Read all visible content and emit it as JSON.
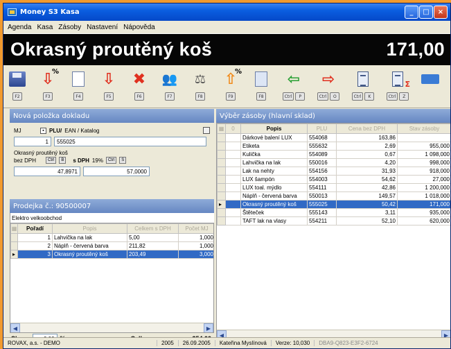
{
  "window": {
    "title": "Money S3 Kasa",
    "controls": {
      "minimize": "_",
      "maximize": "□",
      "close": "×"
    }
  },
  "menu": [
    "Agenda",
    "Kasa",
    "Zásoby",
    "Nastavení",
    "Nápověda"
  ],
  "banner": {
    "item": "Okrasný proutěný koš",
    "price": "171,00"
  },
  "toolbar": [
    {
      "icon": "save-disk-icon",
      "key": "F2"
    },
    {
      "icon": "discount-down-icon",
      "key": "F3"
    },
    {
      "icon": "edit-item-icon",
      "key": "F4"
    },
    {
      "icon": "arrow-down-icon",
      "key": "F5"
    },
    {
      "icon": "delete-x-icon",
      "key": "F6"
    },
    {
      "icon": "customers-icon",
      "key": "F7"
    },
    {
      "icon": "scale-icon",
      "key": "F8"
    },
    {
      "icon": "discount-up-icon",
      "key": "F9"
    },
    {
      "icon": "register-icon",
      "key": "F8"
    },
    {
      "icon": "arrow-left-icon",
      "keys": [
        "Ctrl",
        "P"
      ]
    },
    {
      "icon": "arrow-right-icon",
      "keys": [
        "Ctrl",
        "O"
      ]
    },
    {
      "icon": "document-icon",
      "keys": [
        "Ctrl",
        "K"
      ]
    },
    {
      "icon": "document-sum-icon",
      "keys": [
        "Ctrl",
        "Z"
      ]
    },
    {
      "icon": "keyboard-icon"
    }
  ],
  "new_item": {
    "header": "Nová položka dokladu",
    "mj_label": "MJ",
    "plu_label": "PLU/",
    "ean_label": "EAN / Katalog",
    "quantity": "1",
    "plu": "555025",
    "name": "Okrasný proutěný koš",
    "bez_dph_label": "bez DPH",
    "ctrl": "Ctrl",
    "b_key": "B",
    "s_dph_label": "s DPH",
    "vat": "19%",
    "s_key": "S",
    "price_net": "47,8971",
    "price_gross": "57,0000"
  },
  "receipt": {
    "header": "Prodejka č.: 90500007",
    "customer": "Elektro velkoobchod",
    "columns": [
      "Pořadí",
      "Popis",
      "Celkem s DPH",
      "Počet MJ"
    ],
    "rows": [
      [
        "1",
        "Lahvička na lak",
        "5,00",
        "1,000"
      ],
      [
        "2",
        "Náplň - červená barva",
        "211,82",
        "1,000"
      ],
      [
        "3",
        "Okrasný proutěný koš",
        "203,49",
        "3,000"
      ]
    ],
    "selected_row": 2,
    "discount_label": "Sleva:",
    "discount_value": "0,00",
    "discount_unit": "%",
    "total_label": "Celkem:",
    "total_value": "354,00"
  },
  "stock": {
    "header": "Výběr zásoby (hlavní sklad)",
    "columns": [
      "Popis",
      "PLU",
      "Cena bez DPH",
      "Stav zásoby"
    ],
    "rows": [
      [
        "Dárkové balení LUX",
        "554068",
        "163,86",
        ""
      ],
      [
        "Etiketa",
        "555632",
        "2,69",
        "955,000"
      ],
      [
        "Kulička",
        "554089",
        "0,67",
        "1 098,000"
      ],
      [
        "Lahvička na lak",
        "550016",
        "4,20",
        "998,000"
      ],
      [
        "Lak na nehty",
        "554156",
        "31,93",
        "918,000"
      ],
      [
        "LUX šampón",
        "554003",
        "54,62",
        "27,000"
      ],
      [
        "LUX toal. mýdlo",
        "554111",
        "42,86",
        "1 200,000"
      ],
      [
        "Náplň - červená barva",
        "550013",
        "149,57",
        "1 018,000"
      ],
      [
        "Okrasný proutěný koš",
        "555025",
        "50,42",
        "171,000"
      ],
      [
        "Štěteček",
        "555143",
        "3,11",
        "935,000"
      ],
      [
        "TAFT lak na vlasy",
        "554211",
        "52,10",
        "620,000"
      ]
    ],
    "selected_row": 8
  },
  "status": {
    "company": "ROVAX, a.s. - DEMO",
    "year": "2005",
    "date": "26.09.2005",
    "user": "Kateřina Myslínová",
    "version": "Verze: 10,030",
    "serial": "DBA9-Q823-E3F2-6724"
  }
}
